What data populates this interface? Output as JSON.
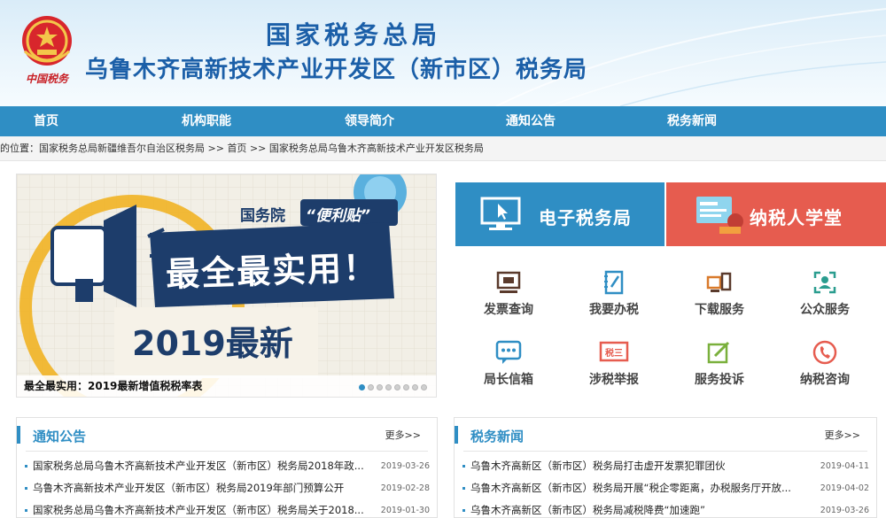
{
  "header": {
    "title": "国家税务总局",
    "subtitle": "乌鲁木齐高新技术产业开发区（新市区）税务局",
    "emblem_text": "中国税务"
  },
  "nav": [
    "首页",
    "机构职能",
    "领导简介",
    "通知公告",
    "税务新闻"
  ],
  "breadcrumb": {
    "prefix": "的位置：",
    "items": [
      "国家税务总局新疆维吾尔自治区税务局",
      "首页",
      "国家税务总局乌鲁木齐高新技术产业开发区税务局"
    ],
    "separator": ">>"
  },
  "banner": {
    "tag_left": "国务院",
    "tag_right": "“便利贴”",
    "headline": "最全最实用！",
    "year_text": "2019最新",
    "caption": "最全最实用：2019最新增值税税率表",
    "dot_count": 8,
    "active_dot": 0
  },
  "tiles": {
    "etax": "电子税务局",
    "school": "纳税人学堂"
  },
  "services": [
    {
      "label": "发票查询",
      "icon": "monitor-icon"
    },
    {
      "label": "我要办税",
      "icon": "notebook-pen-icon"
    },
    {
      "label": "下载服务",
      "icon": "download-devices-icon"
    },
    {
      "label": "公众服务",
      "icon": "person-frame-icon"
    },
    {
      "label": "局长信箱",
      "icon": "chat-bubble-icon"
    },
    {
      "label": "涉税举报",
      "icon": "tax-report-icon"
    },
    {
      "label": "服务投诉",
      "icon": "edit-complaint-icon"
    },
    {
      "label": "纳税咨询",
      "icon": "phone-icon"
    }
  ],
  "notices": {
    "title": "通知公告",
    "more": "更多>>",
    "items": [
      {
        "title": "国家税务总局乌鲁木齐高新技术产业开发区（新市区）税务局2018年政...",
        "date": "2019-03-26"
      },
      {
        "title": "乌鲁木齐高新技术产业开发区（新市区）税务局2019年部门预算公开",
        "date": "2019-02-28"
      },
      {
        "title": "国家税务总局乌鲁木齐高新技术产业开发区（新市区）税务局关于2018...",
        "date": "2019-01-30"
      }
    ]
  },
  "news": {
    "title": "税务新闻",
    "more": "更多>>",
    "items": [
      {
        "title": "乌鲁木齐高新区（新市区）税务局打击虚开发票犯罪团伙",
        "date": "2019-04-11"
      },
      {
        "title": "乌鲁木齐高新区（新市区）税务局开展“税企零距离，办税服务厅开放...",
        "date": "2019-04-02"
      },
      {
        "title": "乌鲁木齐高新区（新市区）税务局减税降费“加速跑”",
        "date": "2019-03-26"
      }
    ]
  },
  "colors": {
    "primary": "#2f8ec4",
    "title_blue": "#1b5fa8",
    "school_red": "#e65c4f",
    "banner_navy": "#1d3d6b"
  }
}
